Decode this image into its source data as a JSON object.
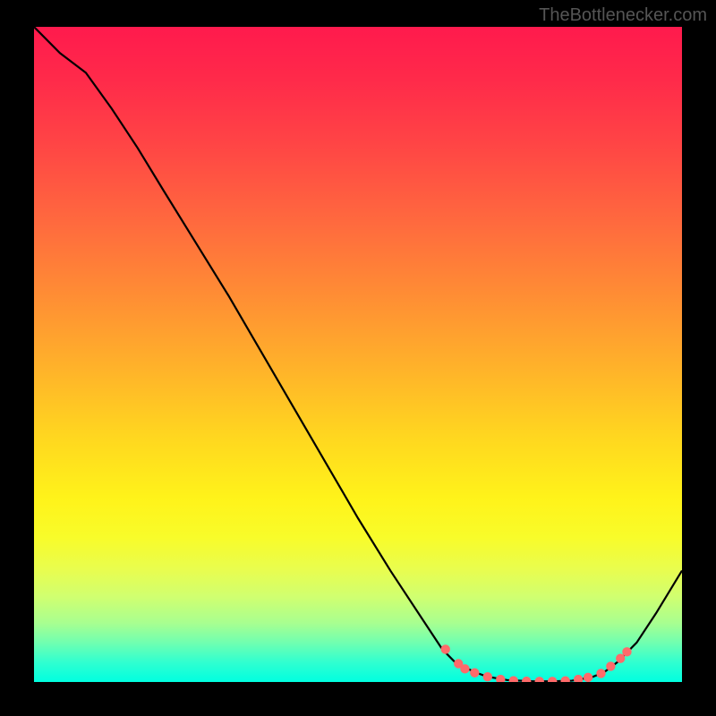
{
  "attribution": "TheBottlenecker.com",
  "chart_data": {
    "type": "line",
    "title": "",
    "xlabel": "",
    "ylabel": "",
    "xlim": [
      0,
      100
    ],
    "ylim": [
      0,
      100
    ],
    "series": [
      {
        "name": "bottleneck-curve",
        "x": [
          0,
          4,
          8,
          12,
          16,
          20,
          25,
          30,
          35,
          40,
          45,
          50,
          55,
          60,
          63,
          65,
          68,
          70,
          73,
          77,
          80,
          83,
          86,
          88,
          90,
          93,
          96,
          100
        ],
        "values": [
          100,
          96,
          93,
          87.5,
          81.5,
          75,
          67,
          59,
          50.5,
          42,
          33.5,
          25,
          17,
          9.5,
          5,
          3,
          1.5,
          0.8,
          0.3,
          0.1,
          0.1,
          0.2,
          0.7,
          1.5,
          3,
          6,
          10.5,
          17
        ]
      }
    ],
    "markers": [
      {
        "x": 63.5,
        "y": 5.0
      },
      {
        "x": 65.5,
        "y": 2.8
      },
      {
        "x": 66.5,
        "y": 2.0
      },
      {
        "x": 68.0,
        "y": 1.4
      },
      {
        "x": 70.0,
        "y": 0.8
      },
      {
        "x": 72.0,
        "y": 0.4
      },
      {
        "x": 74.0,
        "y": 0.2
      },
      {
        "x": 76.0,
        "y": 0.12
      },
      {
        "x": 78.0,
        "y": 0.1
      },
      {
        "x": 80.0,
        "y": 0.1
      },
      {
        "x": 82.0,
        "y": 0.18
      },
      {
        "x": 84.0,
        "y": 0.4
      },
      {
        "x": 85.5,
        "y": 0.7
      },
      {
        "x": 87.5,
        "y": 1.3
      },
      {
        "x": 89.0,
        "y": 2.4
      },
      {
        "x": 90.5,
        "y": 3.6
      },
      {
        "x": 91.5,
        "y": 4.6
      }
    ],
    "marker_color": "#ff6a6a",
    "line_color": "#000000"
  }
}
